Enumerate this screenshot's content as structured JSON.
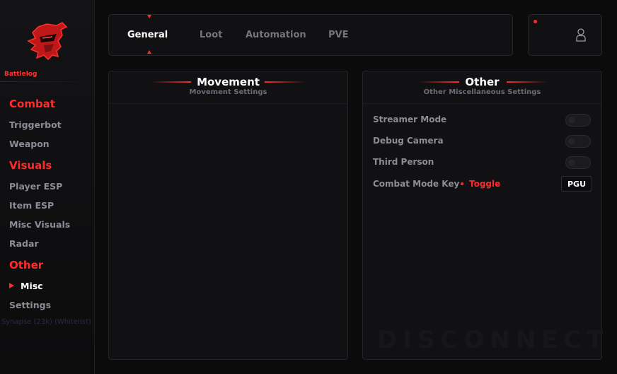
{
  "sidebar": {
    "brand": "Battlelog",
    "sections": [
      {
        "title": "Combat",
        "items": [
          "Triggerbot",
          "Weapon"
        ]
      },
      {
        "title": "Visuals",
        "items": [
          "Player ESP",
          "Item ESP",
          "Misc Visuals",
          "Radar"
        ]
      },
      {
        "title": "Other",
        "items": [
          "Misc",
          "Settings"
        ]
      }
    ],
    "active_item": "Misc",
    "ghost_text": "Synapse (23k) (Whitelist)"
  },
  "tabs": [
    "General",
    "Loot",
    "Automation",
    "PVE"
  ],
  "active_tab": "General",
  "movement_panel": {
    "title": "Movement",
    "subtitle": "Movement Settings"
  },
  "other_panel": {
    "title": "Other",
    "subtitle": "Other Miscellaneous Settings",
    "toggles": [
      {
        "label": "Streamer Mode",
        "on": false
      },
      {
        "label": "Debug Camera",
        "on": false
      },
      {
        "label": "Third Person",
        "on": false
      }
    ],
    "keybind": {
      "label": "Combat Mode Key",
      "mode": "Toggle",
      "key": "PGU"
    },
    "watermark": "DISCONNECT"
  },
  "colors": {
    "accent": "#ff2b2b",
    "panel_bg": "#111113",
    "page_bg": "#0b0b0c",
    "text_muted": "#8d8d96"
  },
  "icons": {
    "logo": "knight-helmet-logo",
    "user": "user-icon",
    "status": "status-dot"
  }
}
